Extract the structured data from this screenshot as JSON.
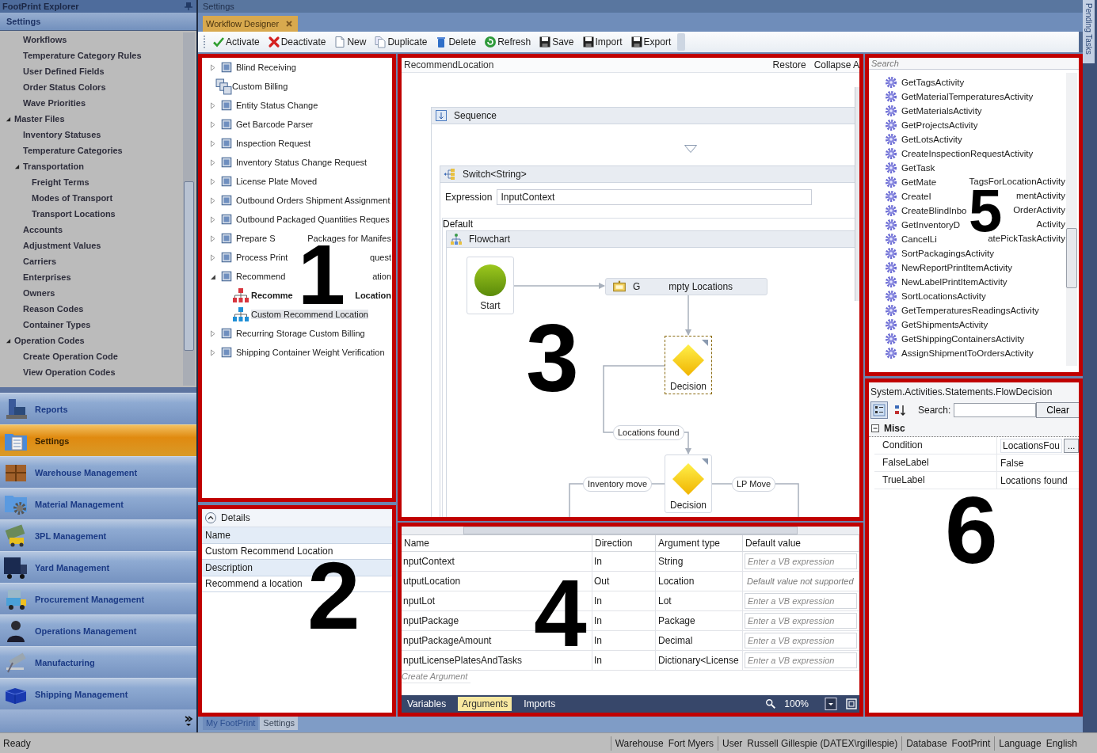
{
  "explorer": {
    "title": "FootPrint Explorer",
    "section": "Settings",
    "tree": [
      {
        "children": [
          {
            "label": "Workflows"
          },
          {
            "label": "Temperature Category Rules"
          },
          {
            "label": "User Defined Fields"
          },
          {
            "label": "Order Status Colors"
          },
          {
            "label": "Wave Priorities"
          }
        ]
      },
      {
        "label": "Master Files",
        "expanded": true,
        "children": [
          {
            "label": "Inventory Statuses"
          },
          {
            "label": "Temperature Categories"
          },
          {
            "label": "Transportation",
            "expanded": true,
            "children": [
              {
                "label": "Freight Terms"
              },
              {
                "label": "Modes of Transport"
              },
              {
                "label": "Transport Locations"
              }
            ]
          },
          {
            "label": "Accounts"
          },
          {
            "label": "Adjustment Values"
          },
          {
            "label": "Carriers"
          },
          {
            "label": "Enterprises"
          },
          {
            "label": "Owners"
          },
          {
            "label": "Reason Codes"
          },
          {
            "label": "Container Types"
          }
        ]
      },
      {
        "label": "Operation Codes",
        "expanded": true,
        "children": [
          {
            "label": "Create Operation Code"
          },
          {
            "label": "View Operation Codes"
          }
        ]
      }
    ],
    "nav": [
      {
        "label": "Reports",
        "kind": "reports",
        "selected": false
      },
      {
        "label": "Settings",
        "kind": "settings",
        "selected": true
      },
      {
        "label": "Warehouse Management",
        "kind": "warehouse",
        "selected": false
      },
      {
        "label": "Material Management",
        "kind": "material",
        "selected": false
      },
      {
        "label": "3PL Management",
        "kind": "logistics",
        "selected": false
      },
      {
        "label": "Yard Management",
        "kind": "yard",
        "selected": false
      },
      {
        "label": "Procurement Management",
        "kind": "procurement",
        "selected": false
      },
      {
        "label": "Operations Management",
        "kind": "operations",
        "selected": false
      },
      {
        "label": "Manufacturing",
        "kind": "manufacturing",
        "selected": false
      },
      {
        "label": "Shipping Management",
        "kind": "shipping",
        "selected": false
      }
    ]
  },
  "document": {
    "title": "Settings",
    "tabs": [
      {
        "label": "Workflow Designer",
        "selected": true
      }
    ],
    "toolbar": [
      {
        "label": "Activate",
        "kind": "activate"
      },
      {
        "label": "Deactivate",
        "kind": "deactivate"
      },
      {
        "label": "New",
        "kind": "new"
      },
      {
        "label": "Duplicate",
        "kind": "duplicate"
      },
      {
        "label": "Delete",
        "kind": "delete"
      },
      {
        "label": "Refresh",
        "kind": "refresh"
      },
      {
        "label": "Save",
        "kind": "save"
      },
      {
        "label": "Import",
        "kind": "import"
      },
      {
        "label": "Export",
        "kind": "export"
      }
    ]
  },
  "workflows": {
    "callout": "1",
    "tree": [
      {
        "label": "Blind Receiving",
        "kind": "group",
        "expanded": false
      },
      {
        "label": "Custom Billing",
        "kind": "set"
      },
      {
        "label": "Entity Status Change",
        "kind": "group",
        "expanded": false
      },
      {
        "label": "Get Barcode Parser",
        "kind": "group",
        "expanded": false
      },
      {
        "label": "Inspection Request",
        "kind": "group",
        "expanded": false
      },
      {
        "label": "Inventory Status Change Request",
        "kind": "group",
        "expanded": false
      },
      {
        "label": "License Plate Moved",
        "kind": "group",
        "expanded": false
      },
      {
        "label": "Outbound Orders Shipment Assignment",
        "kind": "group",
        "expanded": false
      },
      {
        "label": "Outbound Packaged Quantities Reques",
        "kind": "group",
        "expanded": false
      },
      {
        "label": [
          "Prepare S",
          "Packages for Manifes"
        ],
        "kind": "group",
        "expanded": false
      },
      {
        "label": [
          "Process Print",
          "quest"
        ],
        "kind": "group",
        "expanded": false
      },
      {
        "label": [
          "Recommend",
          "ation"
        ],
        "kind": "group",
        "expanded": true,
        "children": [
          {
            "label": [
              "Recomme",
              "Location"
            ],
            "kind": "workflow",
            "color": "#d8363e",
            "default": true,
            "selected": false
          },
          {
            "label": "Custom Recommend Location",
            "kind": "workflow",
            "color": "#1f8fd6",
            "default": false,
            "selected": true
          }
        ]
      },
      {
        "label": "Recurring Storage Custom Billing",
        "kind": "group",
        "expanded": false
      },
      {
        "label": "Shipping Container Weight Verification",
        "kind": "group",
        "expanded": false
      }
    ]
  },
  "details": {
    "callout": "2",
    "title": "Details",
    "expanded": true,
    "fields": [
      {
        "label": "Name",
        "value": "Custom Recommend Location"
      },
      {
        "label": "Description",
        "value": "Recommend a location"
      }
    ]
  },
  "designer": {
    "callout": "3",
    "breadcrumb": "RecommendLocation",
    "actions": [
      "Restore",
      "Collapse A"
    ],
    "sequence": "Sequence",
    "switch": "Switch<String>",
    "expression_label": "Expression",
    "expression": "InputContext",
    "default_label": "Default",
    "flowchart": "Flowchart",
    "nodes": [
      {
        "kind": "start",
        "label": "Start",
        "selected": false
      },
      {
        "kind": "activity",
        "label": [
          "G",
          "mpty Locations"
        ],
        "selected": false
      },
      {
        "kind": "decision",
        "label": "Decision",
        "selected": true
      },
      {
        "kind": "decision",
        "label": "Decision",
        "selected": false
      }
    ],
    "edge_labels": [
      "Locations found",
      "Inventory move",
      "LP Move"
    ]
  },
  "arguments": {
    "callout": "4",
    "columns": [
      "Name",
      "Direction",
      "Argument type",
      "Default value"
    ],
    "rows": [
      {
        "name": "nputContext",
        "direction": "In",
        "type": "String",
        "default": {
          "kind": "field",
          "placeholder": "Enter a VB expression"
        }
      },
      {
        "name": "utputLocation",
        "direction": "Out",
        "type": "Location",
        "default": {
          "kind": "note",
          "text": "Default value not supported"
        }
      },
      {
        "name": "nputLot",
        "direction": "In",
        "type": "Lot",
        "default": {
          "kind": "field",
          "placeholder": "Enter a VB expression"
        }
      },
      {
        "name": "nputPackage",
        "direction": "In",
        "type": "Package",
        "default": {
          "kind": "field",
          "placeholder": "Enter a VB expression"
        }
      },
      {
        "name": "nputPackageAmount",
        "direction": "In",
        "type": "Decimal",
        "default": {
          "kind": "field",
          "placeholder": "Enter a VB expression"
        }
      },
      {
        "name": "nputLicensePlatesAndTasks",
        "direction": "In",
        "type": "Dictionary<License",
        "default": {
          "kind": "field",
          "placeholder": "Enter a VB expression"
        }
      }
    ],
    "create": "Create Argument",
    "tabs": [
      {
        "label": "Variables",
        "selected": false
      },
      {
        "label": "Arguments",
        "selected": true
      },
      {
        "label": "Imports",
        "selected": false
      }
    ],
    "zoom": "100%"
  },
  "toolbox": {
    "callout": "5",
    "placeholder": "Search",
    "items": [
      "GetTagsActivity",
      "GetMaterialTemperaturesActivity",
      "GetMaterialsActivity",
      "GetProjectsActivity",
      "GetLotsActivity",
      "CreateInspectionRequestActivity",
      "GetTask",
      [
        "GetMate",
        "TagsForLocationActivity"
      ],
      [
        "CreateI",
        "mentActivity"
      ],
      [
        "CreateBlindInbo",
        "OrderActivity"
      ],
      [
        "GetInventoryD",
        "Activity"
      ],
      [
        "CancelLi",
        "atePickTaskActivity"
      ],
      "SortPackagingsActivity",
      "NewReportPrintItemActivity",
      "NewLabelPrintItemActivity",
      "SortLocationsActivity",
      "GetTemperaturesReadingsActivity",
      "GetShipmentsActivity",
      "GetShippingContainersActivity",
      "AssignShipmentToOrdersActivity"
    ]
  },
  "properties": {
    "callout": "6",
    "type": "System.Activities.Statements.FlowDecision",
    "views": [
      {
        "kind": "categorized",
        "selected": true
      },
      {
        "kind": "alphabetical",
        "selected": false
      }
    ],
    "search_label": "Search:",
    "clear": "Clear",
    "category": {
      "label": "Misc",
      "expanded": true
    },
    "rows": [
      {
        "name": "Condition",
        "value": "LocationsFou",
        "button": "..."
      },
      {
        "name": "FalseLabel",
        "value": "False"
      },
      {
        "name": "TrueLabel",
        "value": "Locations found"
      }
    ]
  },
  "bottom_tabs": [
    {
      "label": "My FootPrint",
      "selected": false
    },
    {
      "label": "Settings",
      "selected": true
    }
  ],
  "side_tab": "Pending Tasks",
  "status_bar": {
    "message": "Ready",
    "fields": [
      {
        "label": "Warehouse",
        "value": "Fort Myers"
      },
      {
        "label": "User",
        "value": "Russell Gillespie (DATEX\\rgillespie)"
      },
      {
        "label": "Database",
        "value": "FootPrint"
      },
      {
        "label": "Language",
        "value": "English"
      }
    ]
  }
}
